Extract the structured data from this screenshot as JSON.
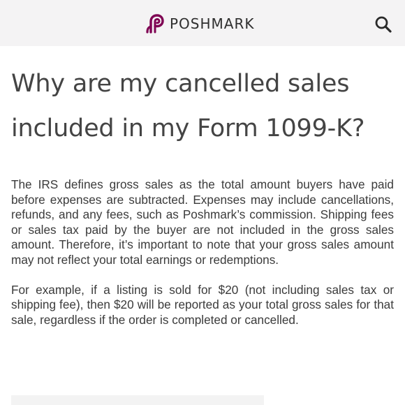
{
  "header": {
    "brand_name": "POSHMARK",
    "logo_icon": "poshmark-logo-icon",
    "search_icon": "search-icon",
    "background_color": "#f4f3f4",
    "logo_color": "#7f0353"
  },
  "article": {
    "title": "Why are my cancelled sales included in my Form 1099-K?",
    "paragraphs": [
      "The IRS defines gross sales as the total amount buyers have paid before expenses are subtracted. Expenses may include cancellations, refunds, and any fees, such as Poshmark’s commission. Shipping fees or sales tax paid by the buyer are not included in the gross sales amount. Therefore, it’s important to note that your gross sales amount may not reflect your total earnings or redemptions.",
      "For example, if a listing is sold for $20 (not including sales tax or shipping fee), then $20 will be reported as your total gross sales for that sale, regardless if the order is completed or cancelled."
    ]
  }
}
